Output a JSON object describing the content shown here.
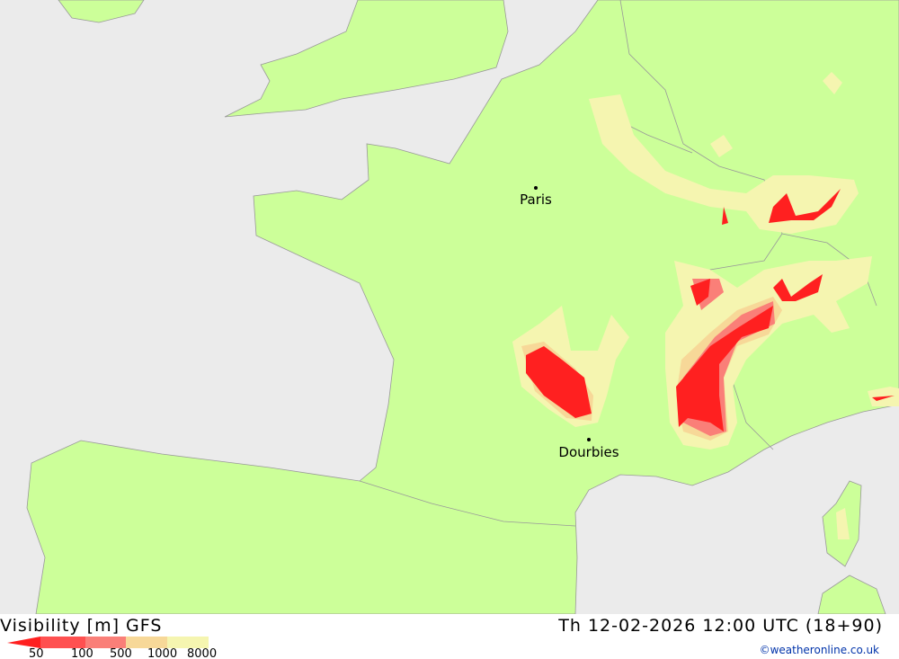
{
  "map": {
    "cities": [
      {
        "name": "Paris"
      },
      {
        "name": "Dourbies"
      }
    ],
    "colors": {
      "sea": "#ebebeb",
      "land": "#ccff99",
      "border": "#999999"
    }
  },
  "footer": {
    "title": "Visibility [m] GFS",
    "datetime": "Th 12-02-2026 12:00 UTC (18+90)",
    "credit": "©weatheronline.co.uk",
    "legend": {
      "labels": [
        "50",
        "100",
        "500",
        "1000",
        "8000"
      ],
      "colors": [
        "#ff2020",
        "#ff5050",
        "#fa7f78",
        "#f7d898",
        "#f5f5b0"
      ]
    }
  }
}
